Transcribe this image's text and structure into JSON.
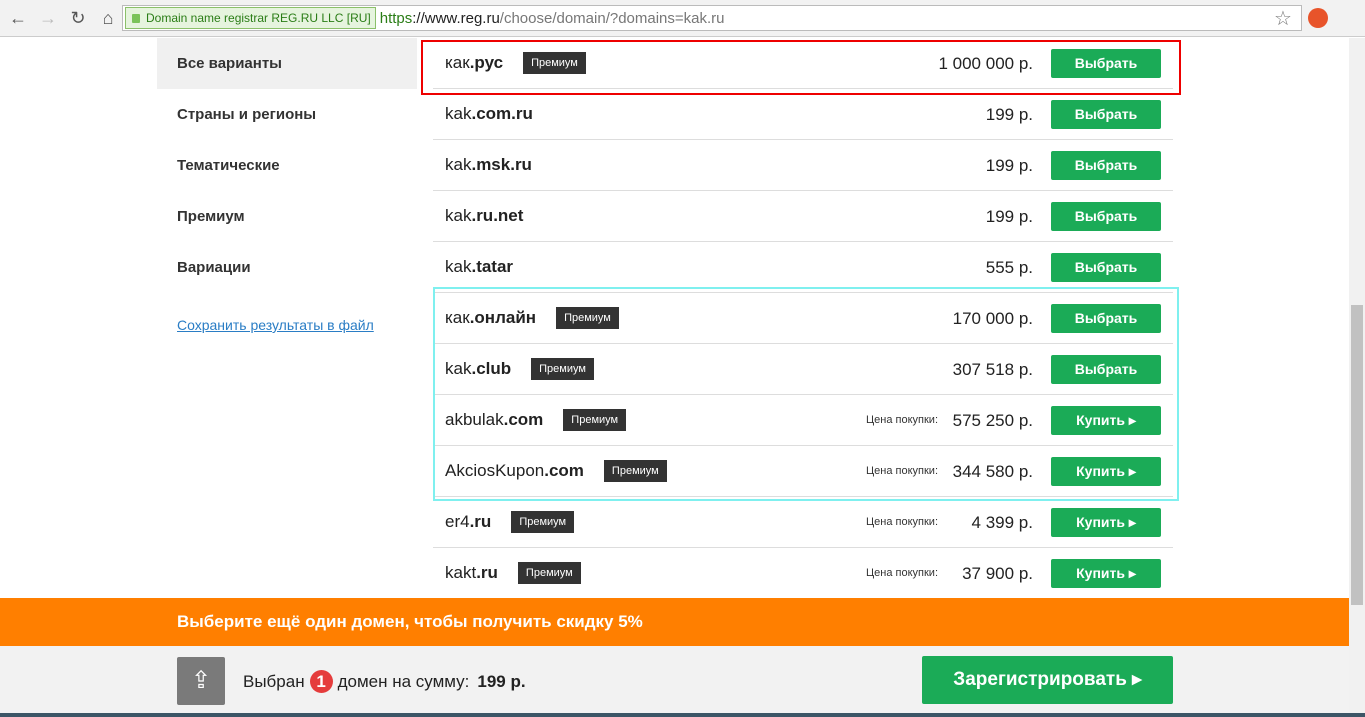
{
  "browser": {
    "ev_label": "Domain name registrar REG.RU LLC [RU]",
    "url_scheme": "https",
    "url_host": "://www.reg.ru",
    "url_path": "/choose/domain/?domains=kak.ru"
  },
  "sidebar": {
    "items": [
      "Все варианты",
      "Страны и регионы",
      "Тематические",
      "Премиум",
      "Вариации"
    ],
    "save_link": "Сохранить результаты в файл"
  },
  "rows": [
    {
      "name": "как",
      "tld": ".рус",
      "badge": "Премиум",
      "price_label": "",
      "price": "1 000 000 р.",
      "button": "Выбрать"
    },
    {
      "name": "kak",
      "tld": ".com.ru",
      "badge": "",
      "price_label": "",
      "price": "199 р.",
      "button": "Выбрать"
    },
    {
      "name": "kak",
      "tld": ".msk.ru",
      "badge": "",
      "price_label": "",
      "price": "199 р.",
      "button": "Выбрать"
    },
    {
      "name": "kak",
      "tld": ".ru.net",
      "badge": "",
      "price_label": "",
      "price": "199 р.",
      "button": "Выбрать"
    },
    {
      "name": "kak",
      "tld": ".tatar",
      "badge": "",
      "price_label": "",
      "price": "555 р.",
      "button": "Выбрать"
    },
    {
      "name": "как",
      "tld": ".онлайн",
      "badge": "Премиум",
      "price_label": "",
      "price": "170 000 р.",
      "button": "Выбрать"
    },
    {
      "name": "kak",
      "tld": ".club",
      "badge": "Премиум",
      "price_label": "",
      "price": "307 518 р.",
      "button": "Выбрать"
    },
    {
      "name": "akbulak",
      "tld": ".com",
      "badge": "Премиум",
      "price_label": "Цена покупки:",
      "price": "575 250 р.",
      "button": "Купить ▸"
    },
    {
      "name": "AkciosKupon",
      "tld": ".com",
      "badge": "Премиум",
      "price_label": "Цена покупки:",
      "price": "344 580 р.",
      "button": "Купить ▸"
    },
    {
      "name": "er4",
      "tld": ".ru",
      "badge": "Премиум",
      "price_label": "Цена покупки:",
      "price": "4 399 р.",
      "button": "Купить ▸"
    },
    {
      "name": "kakt",
      "tld": ".ru",
      "badge": "Премиум",
      "price_label": "Цена покупки:",
      "price": "37 900 р.",
      "button": "Купить ▸"
    }
  ],
  "promo": "Выберите ещё один домен, чтобы получить скидку 5%",
  "cart": {
    "prefix": "Выбран",
    "count": "1",
    "middle": "домен на сумму:",
    "sum": "199 р.",
    "register": "Зарегистрировать ▸"
  }
}
